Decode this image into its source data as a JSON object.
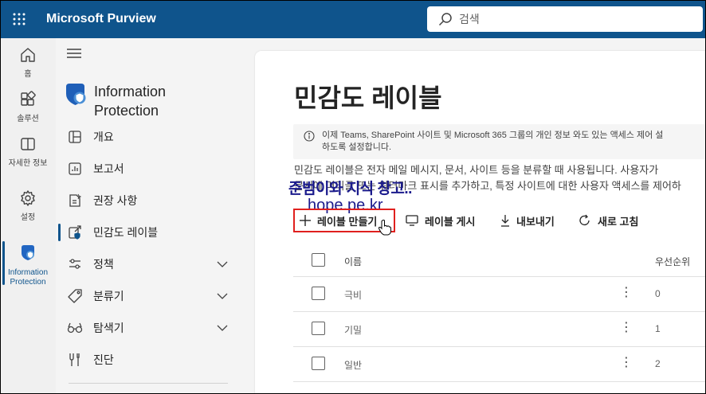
{
  "app": {
    "title": "Microsoft Purview"
  },
  "search": {
    "placeholder": "검색"
  },
  "rail": {
    "items": [
      {
        "label": "홈",
        "icon": "home-icon"
      },
      {
        "label": "솔루션",
        "icon": "solutions-icon"
      },
      {
        "label": "자세한 정보",
        "icon": "learn-icon"
      },
      {
        "label": "설정",
        "icon": "settings-icon"
      },
      {
        "label": "Information Protection",
        "icon": "information-protection-icon"
      }
    ]
  },
  "nav": {
    "header": "Information Protection",
    "items": [
      {
        "label": "개요",
        "icon": "overview-icon"
      },
      {
        "label": "보고서",
        "icon": "reports-icon"
      },
      {
        "label": "권장 사항",
        "icon": "recommendations-icon"
      },
      {
        "label": "민감도 레이블",
        "icon": "sensitivity-label-icon",
        "active": true
      },
      {
        "label": "정책",
        "icon": "policy-icon",
        "expandable": true
      },
      {
        "label": "분류기",
        "icon": "classifier-icon",
        "expandable": true
      },
      {
        "label": "탐색기",
        "icon": "explorer-icon",
        "expandable": true
      },
      {
        "label": "진단",
        "icon": "diagnostics-icon"
      }
    ]
  },
  "main": {
    "title": "민감도 레이블",
    "info_line1": "이제 Teams, SharePoint 사이트 및 Microsoft 365 그룹의 개인 정보 와도 있는 액세스 제어 설",
    "info_line2": "하도록 설정합니다.",
    "desc_line1": "민감도 레이블은 전자 메일 메시지, 문서, 사이트 등을 분류할 때 사용됩니다. 사용자가",
    "desc_line2": "문서에 머리글 또는 워터마크 표시를 추가하고, 특정 사이트에 대한 사용자 액세스를 제어하",
    "watermark_line1": "준범이와 지식 창고..",
    "watermark_line2": "hope.pe.kr"
  },
  "toolbar": {
    "create": "레이블 만들기",
    "publish": "레이블 게시",
    "export": "내보내기",
    "refresh": "새로 고침"
  },
  "table": {
    "headers": {
      "name": "이름",
      "priority": "우선순위"
    },
    "rows": [
      {
        "name": "극비",
        "priority": "0"
      },
      {
        "name": "기밀",
        "priority": "1"
      },
      {
        "name": "일반",
        "priority": "2"
      }
    ]
  },
  "colors": {
    "topbar": "#0f548c",
    "accent": "#0f548c",
    "highlight": "#e0201e"
  }
}
